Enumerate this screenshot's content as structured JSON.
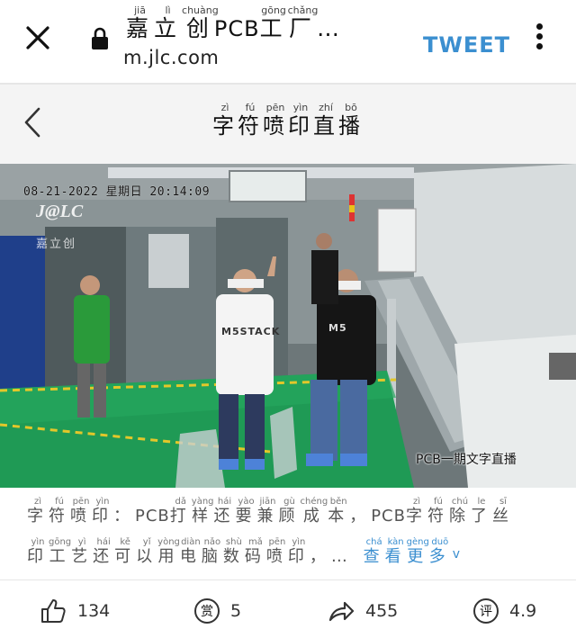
{
  "browser": {
    "title_chars": [
      {
        "char": "嘉",
        "pinyin": "jiā"
      },
      {
        "char": "立",
        "pinyin": "lì"
      },
      {
        "char": "创",
        "pinyin": "chuàng"
      },
      {
        "char": "PCB",
        "pinyin": ""
      },
      {
        "char": "工",
        "pinyin": "gōng"
      },
      {
        "char": "厂",
        "pinyin": "chǎng"
      },
      {
        "char": "…",
        "pinyin": ""
      }
    ],
    "url": "m.jlc.com",
    "tweet_label": "TWEET",
    "icons": {
      "close": "close-icon",
      "lock": "lock-icon",
      "menu": "more-vertical-icon"
    }
  },
  "page": {
    "title_chars": [
      {
        "char": "字",
        "pinyin": "zì"
      },
      {
        "char": "符",
        "pinyin": "fú"
      },
      {
        "char": "喷",
        "pinyin": "pēn"
      },
      {
        "char": "印",
        "pinyin": "yìn"
      },
      {
        "char": "直",
        "pinyin": "zhí"
      },
      {
        "char": "播",
        "pinyin": "bō"
      }
    ],
    "back_icon": "chevron-left-icon"
  },
  "media": {
    "timestamp": "08-21-2022 星期日 20:14:09",
    "watermark_logo": "J@LC",
    "watermark_sub": "嘉立创",
    "shirt_left": "M5STACK",
    "shirt_right": "M5",
    "caption": "PCB一期文字直播"
  },
  "description": {
    "line1": [
      {
        "char": "字",
        "pinyin": "zì"
      },
      {
        "char": "符",
        "pinyin": "fú"
      },
      {
        "char": "喷",
        "pinyin": "pēn"
      },
      {
        "char": "印",
        "pinyin": "yìn"
      },
      {
        "char": "：",
        "pinyin": ""
      },
      {
        "char": "PCB",
        "pinyin": ""
      },
      {
        "char": "打",
        "pinyin": "dǎ"
      },
      {
        "char": "样",
        "pinyin": "yàng"
      },
      {
        "char": "还",
        "pinyin": "hái"
      },
      {
        "char": "要",
        "pinyin": "yào"
      },
      {
        "char": "兼",
        "pinyin": "jiān"
      },
      {
        "char": "顾",
        "pinyin": "gù"
      },
      {
        "char": "成",
        "pinyin": "chéng"
      },
      {
        "char": "本",
        "pinyin": "běn"
      },
      {
        "char": "，",
        "pinyin": ""
      },
      {
        "char": "PCB",
        "pinyin": ""
      },
      {
        "char": "字",
        "pinyin": "zì"
      },
      {
        "char": "符",
        "pinyin": "fú"
      },
      {
        "char": "除",
        "pinyin": "chú"
      },
      {
        "char": "了",
        "pinyin": "le"
      },
      {
        "char": "丝",
        "pinyin": "sī"
      }
    ],
    "line2": [
      {
        "char": "印",
        "pinyin": "yìn"
      },
      {
        "char": "工",
        "pinyin": "gōng"
      },
      {
        "char": "艺",
        "pinyin": "yì"
      },
      {
        "char": "还",
        "pinyin": "hái"
      },
      {
        "char": "可",
        "pinyin": "kě"
      },
      {
        "char": "以",
        "pinyin": "yǐ"
      },
      {
        "char": "用",
        "pinyin": "yòng"
      },
      {
        "char": "电",
        "pinyin": "diàn"
      },
      {
        "char": "脑",
        "pinyin": "nǎo"
      },
      {
        "char": "数",
        "pinyin": "shù"
      },
      {
        "char": "码",
        "pinyin": "mǎ"
      },
      {
        "char": "喷",
        "pinyin": "pēn"
      },
      {
        "char": "印",
        "pinyin": "yìn"
      },
      {
        "char": "，",
        "pinyin": ""
      },
      {
        "char": "…",
        "pinyin": ""
      }
    ],
    "more": [
      {
        "char": "查",
        "pinyin": "chá"
      },
      {
        "char": "看",
        "pinyin": "kàn"
      },
      {
        "char": "更",
        "pinyin": "gèng"
      },
      {
        "char": "多",
        "pinyin": "duō"
      }
    ],
    "more_chevron": "v"
  },
  "actions": {
    "like": {
      "icon": "thumbs-up-icon",
      "count": "134"
    },
    "reward": {
      "icon": "reward-icon",
      "glyph": "赏",
      "count": "5"
    },
    "share": {
      "icon": "share-icon",
      "count": "455"
    },
    "rating": {
      "icon": "rating-icon",
      "glyph": "评",
      "count": "4.9"
    }
  },
  "colors": {
    "accent": "#3b8fd0",
    "header_bg": "#f4f4f4",
    "floor_green": "#1f9a55"
  }
}
